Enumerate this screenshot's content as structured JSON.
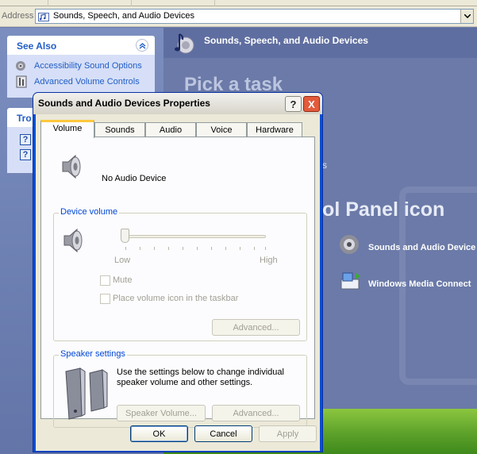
{
  "address": {
    "label": "Address",
    "value": "Sounds, Speech, and Audio Devices"
  },
  "left_pane": {
    "see_also": {
      "title": "See Also",
      "links": [
        "Accessibility Sound Options",
        "Advanced Volume Controls"
      ]
    },
    "troubleshooters": {
      "title": "Tro"
    }
  },
  "main": {
    "header_title": "Sounds, Speech, and Audio Devices",
    "pick_task": "Pick a task",
    "fragment_s": "s",
    "control_panel_icon": "trol Panel icon",
    "items": [
      {
        "label": "Sounds and Audio Device"
      },
      {
        "label": "Windows Media Connect"
      }
    ]
  },
  "dialog": {
    "title": "Sounds and Audio Devices Properties",
    "help_symbol": "?",
    "close_symbol": "X",
    "tabs": [
      "Volume",
      "Sounds",
      "Audio",
      "Voice",
      "Hardware"
    ],
    "active_tab": "Volume",
    "device_name": "No Audio Device",
    "device_volume": {
      "label": "Device volume",
      "low": "Low",
      "high": "High",
      "level": 0,
      "mute_label": "Mute",
      "mute_checked": false,
      "tray_label": "Place volume icon in the taskbar",
      "tray_checked": false,
      "advanced_label": "Advanced..."
    },
    "speaker_settings": {
      "label": "Speaker settings",
      "description": "Use the settings below to change individual speaker volume and other settings.",
      "speaker_volume_label": "Speaker Volume...",
      "advanced_label": "Advanced..."
    },
    "buttons": {
      "ok": "OK",
      "cancel": "Cancel",
      "apply": "Apply"
    }
  },
  "colors": {
    "xp_blue_title": "#0a4fd4",
    "link_blue": "#215dc6",
    "group_label_blue": "#0046d5",
    "pane_background": "#6b7aa8",
    "dialog_face": "#ece9d8"
  },
  "icons": [
    "folder-sound-icon",
    "speaker-icon",
    "help-icon",
    "volume-control-icon",
    "network-media-icon",
    "speakers-icon",
    "collapse-icon"
  ]
}
